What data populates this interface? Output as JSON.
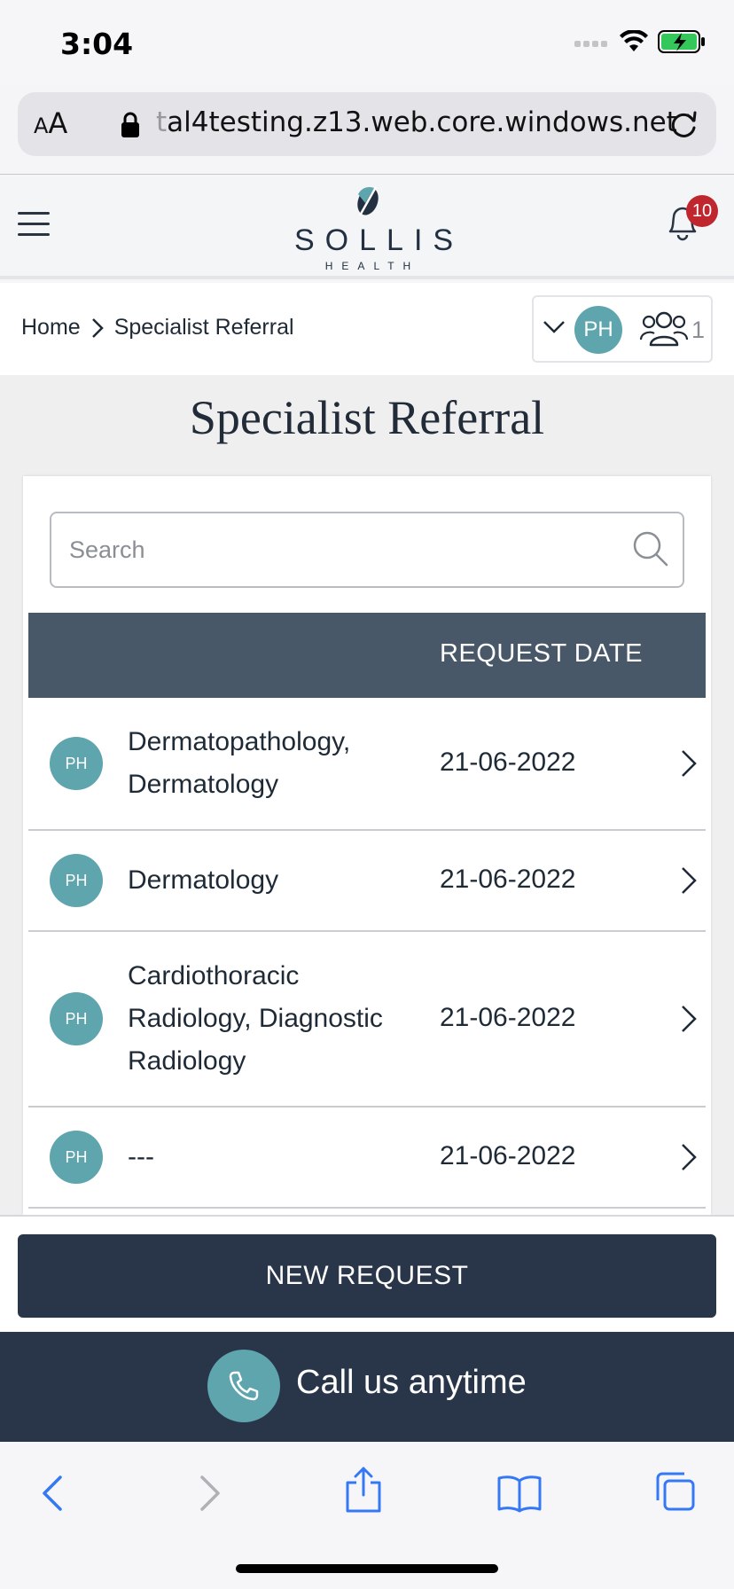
{
  "status_bar": {
    "time": "3:04"
  },
  "browser": {
    "text_size_small": "A",
    "text_size_big": "A",
    "url_dim_prefix": "t",
    "url": "al4testing.z13.web.core.windows.net"
  },
  "header": {
    "logo_name": "SOLLIS",
    "logo_sub": "HEALTH",
    "notification_count": "10"
  },
  "breadcrumb": {
    "home": "Home",
    "current": "Specialist Referral"
  },
  "profile": {
    "initials": "PH",
    "members_count": "1"
  },
  "page": {
    "title": "Specialist Referral",
    "search_placeholder": "Search"
  },
  "table": {
    "header_date": "REQUEST DATE",
    "rows": [
      {
        "initials": "PH",
        "name": "Dermatopathology, Dermatology",
        "date": "21-06-2022"
      },
      {
        "initials": "PH",
        "name": "Dermatology",
        "date": "21-06-2022"
      },
      {
        "initials": "PH",
        "name": "Cardiothoracic Radiology, Diagnostic Radiology",
        "date": "21-06-2022"
      },
      {
        "initials": "PH",
        "name": "---",
        "date": "21-06-2022"
      }
    ]
  },
  "footer": {
    "new_request": "NEW REQUEST",
    "call_text": "Call us anytime"
  },
  "colors": {
    "navy": "#293548",
    "teal": "#5fa5ad",
    "table_header": "#495869",
    "badge_red": "#c0262d",
    "ios_blue": "#3478f6"
  }
}
